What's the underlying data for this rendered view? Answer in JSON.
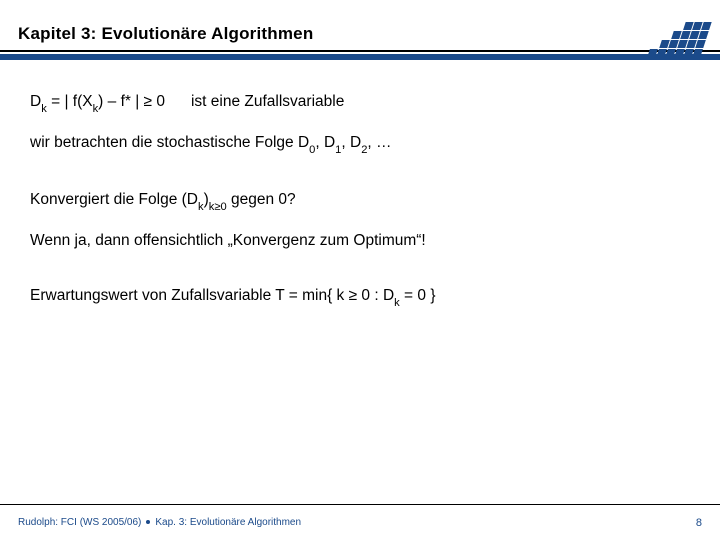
{
  "header": {
    "title": "Kapitel 3: Evolutionäre Algorithmen"
  },
  "body": {
    "line1_pre": "D",
    "line1_sub1": "k",
    "line1_mid1": " = | f(X",
    "line1_sub2": "k",
    "line1_mid2": ") – f* |  ≥  0",
    "line1_tail": "ist eine Zufallsvariable",
    "line2_pre": "wir betrachten die stochastische Folge D",
    "line2_s0": "0",
    "line2_c1": ", D",
    "line2_s1": "1",
    "line2_c2": ", D",
    "line2_s2": "2",
    "line2_end": ", …",
    "line3_pre": "Konvergiert die Folge (D",
    "line3_s1": "k",
    "line3_mid": ")",
    "line3_s2": "k≥0",
    "line3_end": " gegen 0?",
    "line4": "Wenn ja, dann offensichtlich „Konvergenz zum Optimum“!",
    "line5_pre": "Erwartungswert von Zufallsvariable T = min{ k ≥ 0 : D",
    "line5_s1": "k",
    "line5_end": " = 0 }"
  },
  "footer": {
    "left_a": "Rudolph: FCI (WS 2005/06)",
    "left_b": "Kap. 3: Evolutionäre Algorithmen",
    "page": "8"
  }
}
